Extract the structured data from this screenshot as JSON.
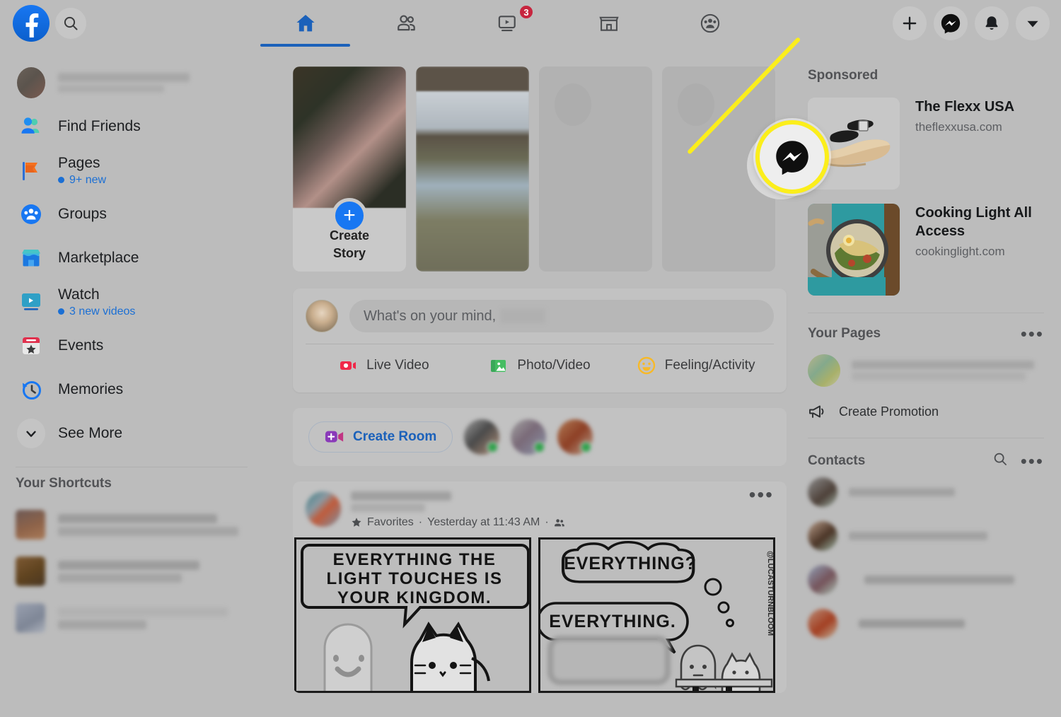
{
  "app": {
    "name": "Facebook",
    "brand_color": "#1877f2",
    "bg_color": "#bcbcbc",
    "highlight_color": "#fbee1b"
  },
  "topnav": {
    "logo_name": "facebook-logo",
    "search_placeholder": "Search Facebook",
    "tabs": [
      {
        "name": "home",
        "label": "Home",
        "icon": "home-icon",
        "active": true,
        "badge": ""
      },
      {
        "name": "friends",
        "label": "Friends",
        "icon": "friends-icon",
        "active": false,
        "badge": ""
      },
      {
        "name": "watch",
        "label": "Watch",
        "icon": "watch-icon",
        "active": false,
        "badge": "3"
      },
      {
        "name": "marketplace",
        "label": "Marketplace",
        "icon": "marketplace-icon",
        "active": false,
        "badge": ""
      },
      {
        "name": "groups",
        "label": "Groups",
        "icon": "groups-icon",
        "active": false,
        "badge": ""
      }
    ],
    "actions": [
      {
        "name": "create",
        "label": "Create",
        "icon": "plus-icon"
      },
      {
        "name": "messenger",
        "label": "Messenger",
        "icon": "messenger-icon"
      },
      {
        "name": "notifications",
        "label": "Notifications",
        "icon": "bell-icon"
      },
      {
        "name": "account",
        "label": "Account",
        "icon": "chevron-down-icon"
      }
    ]
  },
  "sidebar": {
    "profile": {
      "name_redacted": true,
      "label": ""
    },
    "items": [
      {
        "label": "Find Friends",
        "icon": "find-friends-icon",
        "sub": ""
      },
      {
        "label": "Pages",
        "icon": "pages-flag-icon",
        "sub": "9+ new"
      },
      {
        "label": "Groups",
        "icon": "groups-circle-icon",
        "sub": ""
      },
      {
        "label": "Marketplace",
        "icon": "marketplace-store-icon",
        "sub": ""
      },
      {
        "label": "Watch",
        "icon": "watch-screen-icon",
        "sub": "3 new videos"
      },
      {
        "label": "Events",
        "icon": "events-calendar-icon",
        "sub": ""
      },
      {
        "label": "Memories",
        "icon": "memories-clock-icon",
        "sub": ""
      },
      {
        "label": "See More",
        "icon": "chevron-down-icon",
        "sub": ""
      }
    ],
    "shortcuts_title": "Your Shortcuts",
    "shortcuts": [
      {
        "label": "",
        "redacted": true
      },
      {
        "label": "",
        "redacted": true
      },
      {
        "label": "",
        "redacted": true
      }
    ]
  },
  "feed": {
    "stories": [
      {
        "name": "create-story",
        "label_line1": "Create",
        "label_line2": "Story",
        "type": "create"
      },
      {
        "name": "story-2",
        "label": "",
        "type": "photo"
      },
      {
        "name": "story-3",
        "label": "",
        "type": "placeholder"
      },
      {
        "name": "story-4",
        "label": "",
        "type": "placeholder"
      }
    ],
    "composer": {
      "placeholder": "What's on your mind,",
      "actions": [
        {
          "label": "Live Video",
          "icon": "live-video-icon",
          "color": "#f02849"
        },
        {
          "label": "Photo/Video",
          "icon": "photo-video-icon",
          "color": "#45bd62"
        },
        {
          "label": "Feeling/Activity",
          "icon": "feeling-activity-icon",
          "color": "#f7b928"
        }
      ]
    },
    "room": {
      "create_room_label": "Create Room",
      "icon": "video-camera-plus-icon",
      "active_friends": 3
    },
    "post": {
      "author_redacted": true,
      "audience_label": "Favorites",
      "timestamp": "Yesterday at 11:43 AM",
      "favorites_icon": "star-icon",
      "privacy_icon": "friends-privacy-icon",
      "menu_icon": "ellipsis-icon",
      "comic": {
        "panel1_lines": [
          "EVERYTHING THE",
          "LIGHT TOUCHES IS",
          "YOUR KINGDOM."
        ],
        "panel2_thought": "EVERYTHING?",
        "panel2_speech": "EVERYTHING.",
        "credit": "@LUCASTURNBLOOM"
      }
    }
  },
  "right": {
    "sponsored_title": "Sponsored",
    "sponsored": [
      {
        "name": "The Flexx USA",
        "url": "theflexxusa.com",
        "image": "sandal-photo"
      },
      {
        "name": "Cooking Light All Access",
        "url": "cookinglight.com",
        "image": "pasta-skillet-photo"
      }
    ],
    "your_pages_title": "Your Pages",
    "your_pages_menu_icon": "ellipsis-icon",
    "page_redacted": true,
    "create_promotion_label": "Create Promotion",
    "create_promotion_icon": "megaphone-icon",
    "contacts_title": "Contacts",
    "contacts_search_icon": "search-icon",
    "contacts_menu_icon": "ellipsis-icon",
    "contacts_count": 4
  },
  "callout": {
    "target": "messenger-icon",
    "description": "Yellow highlight pointing to Messenger button in top navigation",
    "color": "#fbee1b"
  }
}
